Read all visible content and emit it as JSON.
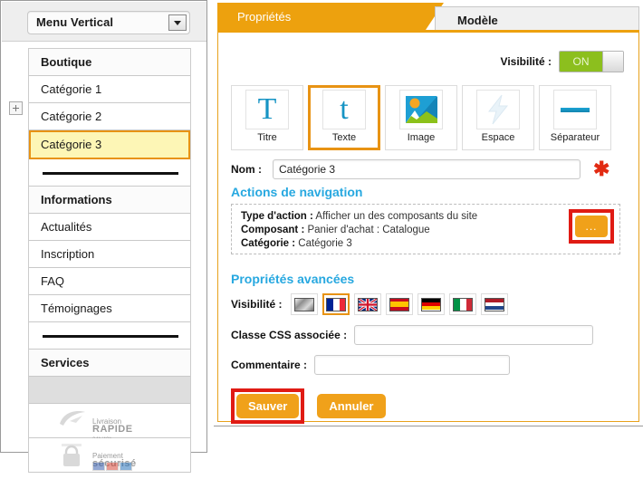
{
  "sidebar": {
    "dropdown": {
      "value": "Menu Vertical",
      "caret_icon": "chevron-down-icon"
    },
    "expander_icon": "plus-box-icon",
    "items": [
      {
        "label": "Boutique",
        "type": "header"
      },
      {
        "label": "Catégorie 1",
        "type": "item"
      },
      {
        "label": "Catégorie 2",
        "type": "item"
      },
      {
        "label": "Catégorie 3",
        "type": "item",
        "selected": true
      },
      {
        "label": "",
        "type": "separator"
      },
      {
        "label": "Informations",
        "type": "header"
      },
      {
        "label": "Actualités",
        "type": "item"
      },
      {
        "label": "Inscription",
        "type": "item"
      },
      {
        "label": "FAQ",
        "type": "item"
      },
      {
        "label": "Témoignages",
        "type": "item"
      },
      {
        "label": "",
        "type": "separator"
      },
      {
        "label": "Services",
        "type": "header"
      },
      {
        "label": "",
        "type": "blank"
      }
    ],
    "badges": [
      {
        "line1": "Livraison",
        "line2": "RAPIDE",
        "line3": "24h/48h",
        "icon": "delivery-swoosh-icon"
      },
      {
        "line1": "Paiement",
        "line2": "sécurisé",
        "line3": "",
        "icon": "padlock-icon"
      }
    ]
  },
  "tabs": [
    {
      "label": "Propriétés",
      "active": true
    },
    {
      "label": "Modèle",
      "active": false
    }
  ],
  "panel": {
    "visibility": {
      "label": "Visibilité :",
      "state": "ON"
    },
    "component_types": [
      {
        "label": "Titre",
        "icon": "title-T-icon",
        "selected": false
      },
      {
        "label": "Texte",
        "icon": "text-t-icon",
        "selected": true
      },
      {
        "label": "Image",
        "icon": "picture-icon",
        "selected": false
      },
      {
        "label": "Espace",
        "icon": "lightning-spacer-icon",
        "selected": false
      },
      {
        "label": "Séparateur",
        "icon": "horizontal-rule-icon",
        "selected": false
      }
    ],
    "name_field": {
      "label": "Nom :",
      "value": "Catégorie 3",
      "placeholder": "",
      "required_marker": "✱"
    },
    "navigation": {
      "title": "Actions de navigation",
      "rows": [
        {
          "key": "Type d'action :",
          "value": "Afficher un des composants du site"
        },
        {
          "key": "Composant :",
          "value": "Panier d'achat : Catalogue"
        },
        {
          "key": "Catégorie :",
          "value": "Catégorie 3"
        }
      ],
      "edit_button": {
        "label": "...",
        "icon": "ellipsis-icon"
      }
    },
    "advanced": {
      "title": "Propriétés avancées",
      "visibility_label": "Visibilité :",
      "flags": [
        {
          "name": "all-languages",
          "selected": false
        },
        {
          "name": "france",
          "selected": true
        },
        {
          "name": "united-kingdom",
          "selected": false
        },
        {
          "name": "spain",
          "selected": false
        },
        {
          "name": "germany",
          "selected": false
        },
        {
          "name": "italy",
          "selected": false
        },
        {
          "name": "netherlands",
          "selected": false
        }
      ],
      "css_class": {
        "label": "Classe CSS associée :",
        "value": "",
        "placeholder": ""
      },
      "comment": {
        "label": "Commentaire :",
        "value": "",
        "placeholder": ""
      }
    },
    "actions": {
      "save": "Sauver",
      "cancel": "Annuler"
    }
  },
  "colors": {
    "accent_orange": "#eda10e",
    "highlight_yellow": "#fdf6b6",
    "selection_border": "#e89314",
    "annotation_red": "#e01b14",
    "toggle_green": "#8cbf1e",
    "section_blue": "#27a8e0"
  }
}
